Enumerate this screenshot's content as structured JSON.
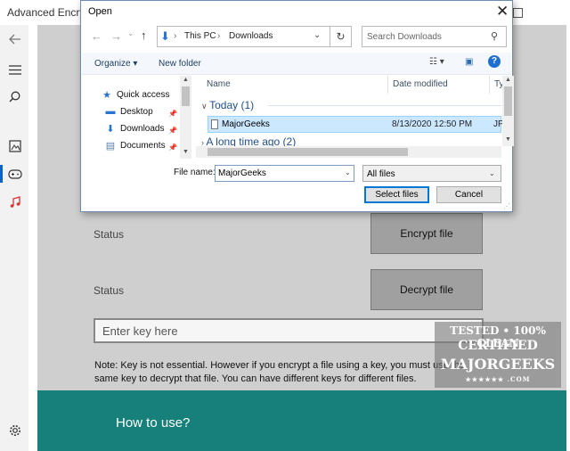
{
  "app": {
    "title": "Advanced Encryptio",
    "status_label_1": "Status",
    "status_label_2": "Status",
    "encrypt_button": "Encrypt file",
    "decrypt_button": "Decrypt file",
    "key_placeholder": "Enter key here",
    "note": "Note: Key is not essential. However if you encrypt a file using a key, you must use the same key to decrypt that file. You can have different keys for different files.",
    "how_to_use": "How to use?"
  },
  "watermark": {
    "line1": "TESTED • 100% CLEAN",
    "line2": "CERTIFIED",
    "line3": "MAJORGEEKS",
    "line4": "★★★★★★ .COM"
  },
  "dialog": {
    "title": "Open",
    "breadcrumb": [
      "This PC",
      "Downloads"
    ],
    "search_placeholder": "Search Downloads",
    "toolbar": {
      "organize": "Organize ▾",
      "new_folder": "New folder"
    },
    "quick_access": [
      {
        "label": "Quick access",
        "icon": "star-icon"
      },
      {
        "label": "Desktop",
        "icon": "desktop-icon"
      },
      {
        "label": "Downloads",
        "icon": "download-icon"
      },
      {
        "label": "Documents",
        "icon": "document-icon"
      }
    ],
    "columns": {
      "name": "Name",
      "date": "Date modified",
      "type": "Ty"
    },
    "groups": [
      {
        "label": "Today (1)"
      },
      {
        "label": "A long time ago (2)"
      }
    ],
    "files": [
      {
        "name": "MajorGeeks",
        "date": "8/13/2020 12:50 PM",
        "type": "JP"
      }
    ],
    "file_name_label": "File name:",
    "file_name_value": "MajorGeeks",
    "file_type": "All files",
    "select_button": "Select files",
    "cancel_button": "Cancel"
  },
  "colors": {
    "accent": "#0a64c8",
    "teal": "#17807a",
    "selection": "#cce8ff"
  }
}
